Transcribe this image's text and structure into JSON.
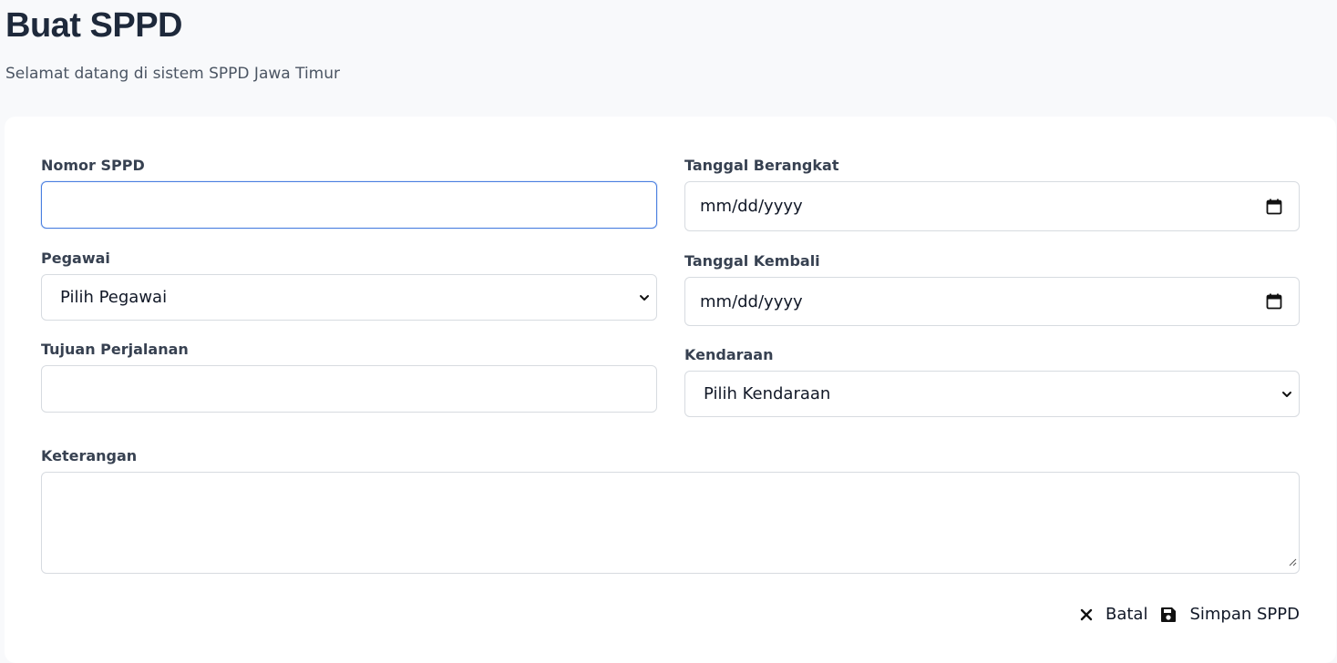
{
  "header": {
    "title": "Buat SPPD",
    "subtitle": "Selamat datang di sistem SPPD Jawa Timur"
  },
  "form": {
    "nomor": {
      "label": "Nomor SPPD",
      "value": ""
    },
    "pegawai": {
      "label": "Pegawai",
      "selected": "Pilih Pegawai"
    },
    "tujuan": {
      "label": "Tujuan Perjalanan",
      "value": ""
    },
    "tanggal_berangkat": {
      "label": "Tanggal Berangkat",
      "placeholder": "mm/dd/yyyy"
    },
    "tanggal_kembali": {
      "label": "Tanggal Kembali",
      "placeholder": "mm/dd/yyyy"
    },
    "kendaraan": {
      "label": "Kendaraan",
      "selected": "Pilih Kendaraan"
    },
    "keterangan": {
      "label": "Keterangan",
      "value": ""
    }
  },
  "actions": {
    "cancel_label": "Batal",
    "save_label": "Simpan SPPD"
  },
  "icons": {
    "calendar": "calendar-icon",
    "chevron": "chevron-down-icon",
    "close": "close-icon",
    "save": "save-icon"
  },
  "colors": {
    "focus_border": "#4a7fe0",
    "title": "#1e293b",
    "background": "#f8f9fb"
  }
}
